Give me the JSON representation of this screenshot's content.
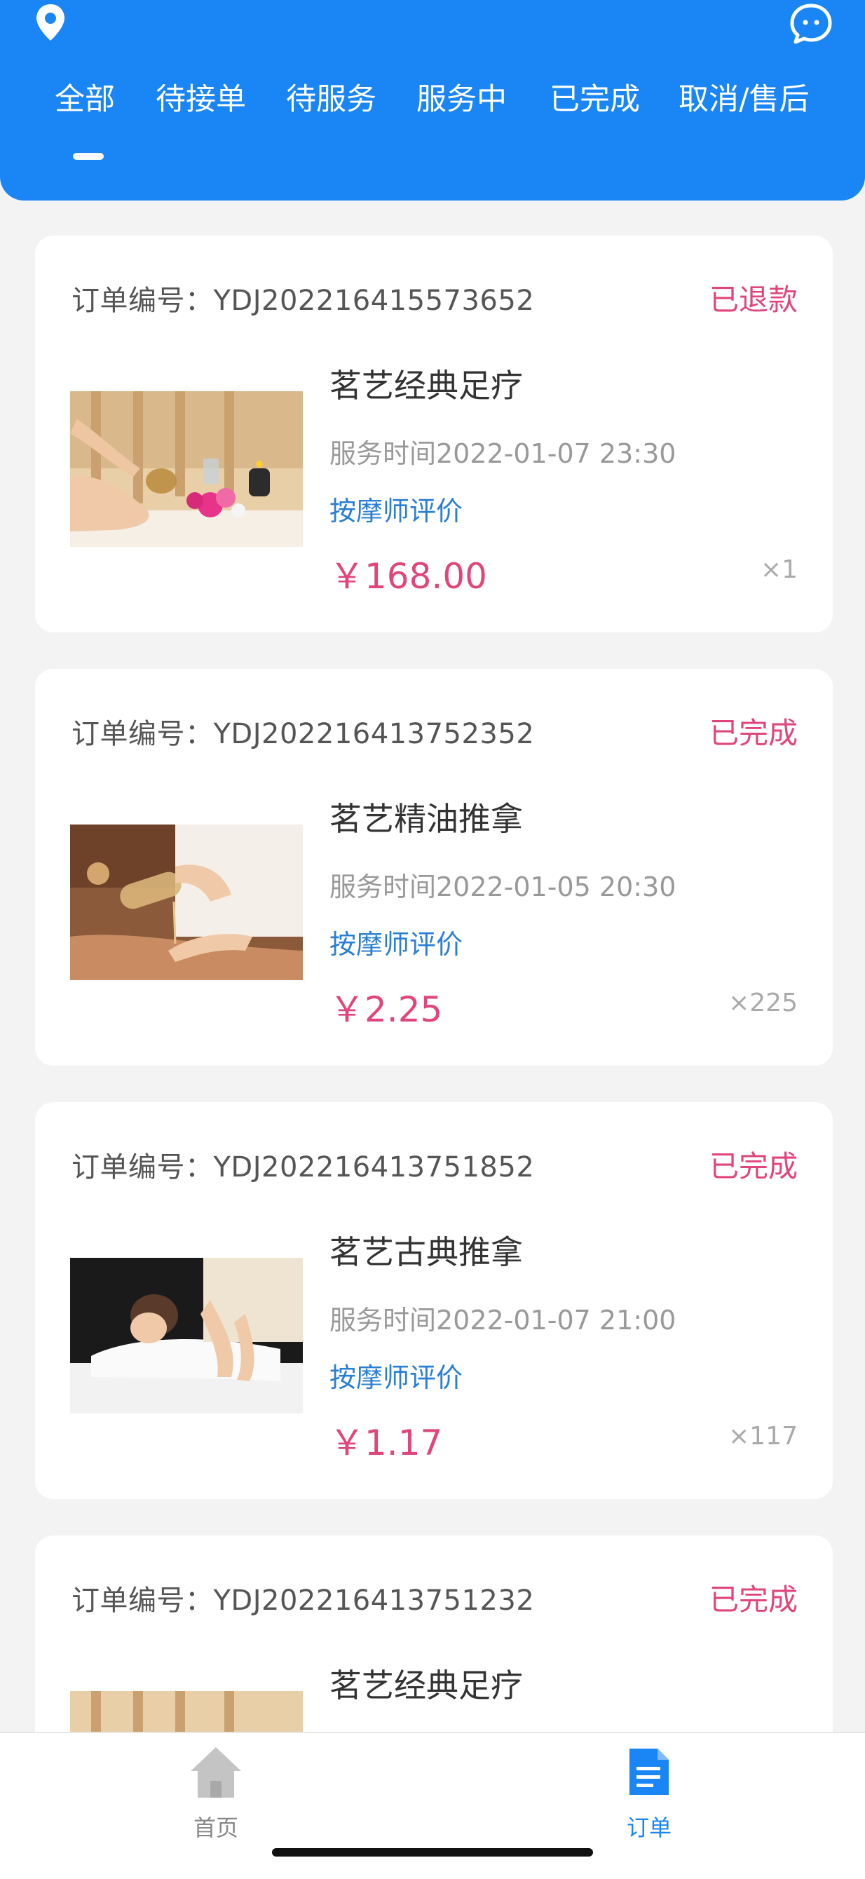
{
  "header": {
    "tabs": [
      "全部",
      "待接单",
      "待服务",
      "服务中",
      "已完成",
      "取消/售后"
    ],
    "active_tab": "全部"
  },
  "orders": [
    {
      "order_no": "订单编号：YDJ202216415573652",
      "status": "已退款",
      "service_name": "茗艺经典足疗",
      "service_time": "服务时间2022-01-07 23:30",
      "review_label": "按摩师评价",
      "price": "￥168.00",
      "quantity": "×1"
    },
    {
      "order_no": "订单编号：YDJ202216413752352",
      "status": "已完成",
      "service_name": "茗艺精油推拿",
      "service_time": "服务时间2022-01-05 20:30",
      "review_label": "按摩师评价",
      "price": "￥2.25",
      "quantity": "×225"
    },
    {
      "order_no": "订单编号：YDJ202216413751852",
      "status": "已完成",
      "service_name": "茗艺古典推拿",
      "service_time": "服务时间2022-01-07 21:00",
      "review_label": "按摩师评价",
      "price": "￥1.17",
      "quantity": "×117"
    },
    {
      "order_no": "订单编号：YDJ202216413751232",
      "status": "已完成",
      "service_name": "茗艺经典足疗"
    }
  ],
  "tabbar": {
    "home_label": "首页",
    "orders_label": "订单",
    "active": "订单"
  },
  "colors": {
    "brand": "#1a85f5",
    "accent_pink": "#e0467c",
    "link_blue": "#2a7fd4",
    "background": "#f3f3f3"
  },
  "icons": {
    "location": "location-pin-icon",
    "chat": "chat-bubble-icon",
    "home": "home-icon",
    "orders": "document-icon"
  }
}
